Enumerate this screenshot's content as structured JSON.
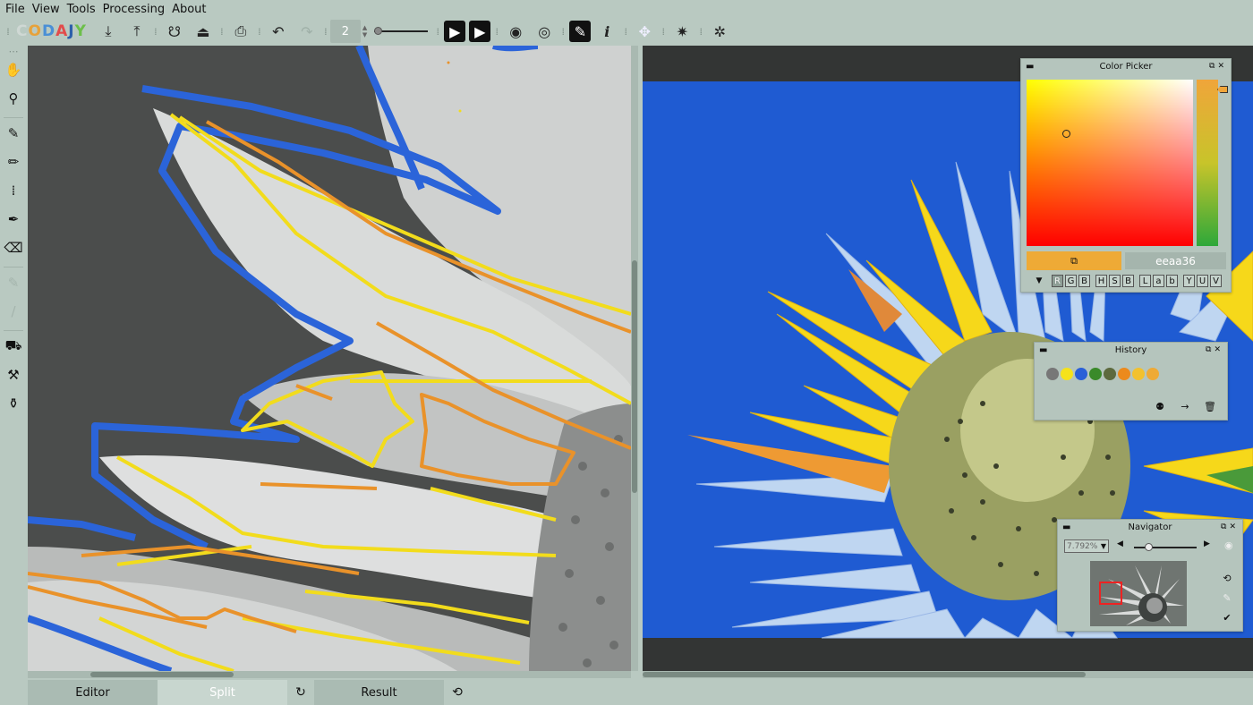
{
  "menu": [
    "File",
    "View",
    "Tools",
    "Processing",
    "About"
  ],
  "logo": [
    "C",
    "O",
    "D",
    "A",
    "J",
    "Y"
  ],
  "toolbar": {
    "brush_size": "2",
    "icons": {
      "open": "⤓",
      "save": "⤒",
      "load_scribbles": "☋",
      "save_scribbles": "⏏",
      "print": "⎙",
      "undo": "↶",
      "redo": "↷",
      "step": "▶",
      "play": "▶",
      "show": "◉",
      "hide": "◎",
      "brush_mode": "✎",
      "info": "i",
      "fullscreen": "✥",
      "favorite": "✷",
      "bug": "✲"
    }
  },
  "left_tools": {
    "pan": "✋",
    "zoom": "⚲",
    "brush": "✎",
    "pencil": "✏",
    "dotted_brush": "⁞",
    "marker": "✒",
    "eraser": "⌫",
    "disabled1": "✎",
    "disabled2": "/",
    "fill": "⛟",
    "stamp": "⚒",
    "eyedropper": "⚱"
  },
  "tabs": {
    "editor": "Editor",
    "split": "Split",
    "result": "Result",
    "split_icon": "↻",
    "result_icon": "⟲"
  },
  "color_picker": {
    "title": "Color Picker",
    "hex": "eeaa36",
    "swatch_color": "#eeaa36",
    "swatch_icon": "⧉",
    "arrow": "▼",
    "modes": [
      "R",
      "G",
      "B",
      "H",
      "S",
      "B",
      "L",
      "a",
      "b",
      "Y",
      "U",
      "V"
    ]
  },
  "history": {
    "title": "History",
    "colors": [
      "#777777",
      "#f5e21b",
      "#2a5fd8",
      "#3a8a2a",
      "#5d6a3e",
      "#ec8a1c",
      "#f2c12e",
      "#eeaa36"
    ],
    "actions": {
      "groups": "⚉",
      "apply": "→",
      "delete": "🗑"
    }
  },
  "navigator": {
    "title": "Navigator",
    "zoom": "7.792%",
    "prev": "◀",
    "next": "▶",
    "eye": "◉",
    "tools": {
      "lasso": "⟲",
      "pen": "✎",
      "check": "✔"
    }
  },
  "panel_buttons": {
    "minimize": "▬",
    "float": "⧉",
    "close": "✕"
  }
}
